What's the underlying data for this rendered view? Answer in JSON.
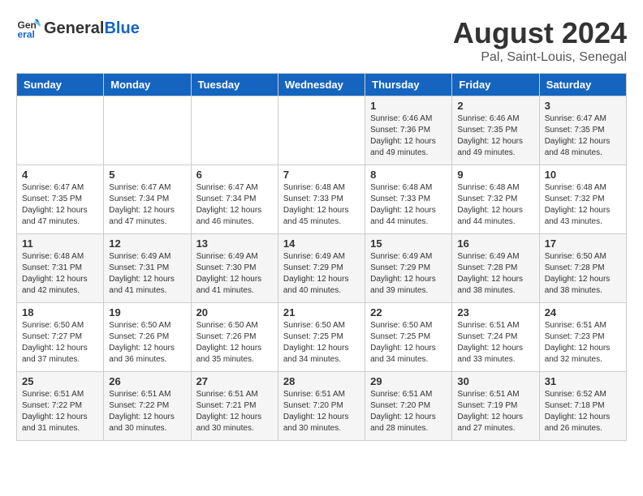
{
  "header": {
    "logo_general": "General",
    "logo_blue": "Blue",
    "month_year": "August 2024",
    "location": "Pal, Saint-Louis, Senegal"
  },
  "days_of_week": [
    "Sunday",
    "Monday",
    "Tuesday",
    "Wednesday",
    "Thursday",
    "Friday",
    "Saturday"
  ],
  "weeks": [
    [
      {
        "day": "",
        "info": ""
      },
      {
        "day": "",
        "info": ""
      },
      {
        "day": "",
        "info": ""
      },
      {
        "day": "",
        "info": ""
      },
      {
        "day": "1",
        "info": "Sunrise: 6:46 AM\nSunset: 7:36 PM\nDaylight: 12 hours\nand 49 minutes."
      },
      {
        "day": "2",
        "info": "Sunrise: 6:46 AM\nSunset: 7:35 PM\nDaylight: 12 hours\nand 49 minutes."
      },
      {
        "day": "3",
        "info": "Sunrise: 6:47 AM\nSunset: 7:35 PM\nDaylight: 12 hours\nand 48 minutes."
      }
    ],
    [
      {
        "day": "4",
        "info": "Sunrise: 6:47 AM\nSunset: 7:35 PM\nDaylight: 12 hours\nand 47 minutes."
      },
      {
        "day": "5",
        "info": "Sunrise: 6:47 AM\nSunset: 7:34 PM\nDaylight: 12 hours\nand 47 minutes."
      },
      {
        "day": "6",
        "info": "Sunrise: 6:47 AM\nSunset: 7:34 PM\nDaylight: 12 hours\nand 46 minutes."
      },
      {
        "day": "7",
        "info": "Sunrise: 6:48 AM\nSunset: 7:33 PM\nDaylight: 12 hours\nand 45 minutes."
      },
      {
        "day": "8",
        "info": "Sunrise: 6:48 AM\nSunset: 7:33 PM\nDaylight: 12 hours\nand 44 minutes."
      },
      {
        "day": "9",
        "info": "Sunrise: 6:48 AM\nSunset: 7:32 PM\nDaylight: 12 hours\nand 44 minutes."
      },
      {
        "day": "10",
        "info": "Sunrise: 6:48 AM\nSunset: 7:32 PM\nDaylight: 12 hours\nand 43 minutes."
      }
    ],
    [
      {
        "day": "11",
        "info": "Sunrise: 6:48 AM\nSunset: 7:31 PM\nDaylight: 12 hours\nand 42 minutes."
      },
      {
        "day": "12",
        "info": "Sunrise: 6:49 AM\nSunset: 7:31 PM\nDaylight: 12 hours\nand 41 minutes."
      },
      {
        "day": "13",
        "info": "Sunrise: 6:49 AM\nSunset: 7:30 PM\nDaylight: 12 hours\nand 41 minutes."
      },
      {
        "day": "14",
        "info": "Sunrise: 6:49 AM\nSunset: 7:29 PM\nDaylight: 12 hours\nand 40 minutes."
      },
      {
        "day": "15",
        "info": "Sunrise: 6:49 AM\nSunset: 7:29 PM\nDaylight: 12 hours\nand 39 minutes."
      },
      {
        "day": "16",
        "info": "Sunrise: 6:49 AM\nSunset: 7:28 PM\nDaylight: 12 hours\nand 38 minutes."
      },
      {
        "day": "17",
        "info": "Sunrise: 6:50 AM\nSunset: 7:28 PM\nDaylight: 12 hours\nand 38 minutes."
      }
    ],
    [
      {
        "day": "18",
        "info": "Sunrise: 6:50 AM\nSunset: 7:27 PM\nDaylight: 12 hours\nand 37 minutes."
      },
      {
        "day": "19",
        "info": "Sunrise: 6:50 AM\nSunset: 7:26 PM\nDaylight: 12 hours\nand 36 minutes."
      },
      {
        "day": "20",
        "info": "Sunrise: 6:50 AM\nSunset: 7:26 PM\nDaylight: 12 hours\nand 35 minutes."
      },
      {
        "day": "21",
        "info": "Sunrise: 6:50 AM\nSunset: 7:25 PM\nDaylight: 12 hours\nand 34 minutes."
      },
      {
        "day": "22",
        "info": "Sunrise: 6:50 AM\nSunset: 7:25 PM\nDaylight: 12 hours\nand 34 minutes."
      },
      {
        "day": "23",
        "info": "Sunrise: 6:51 AM\nSunset: 7:24 PM\nDaylight: 12 hours\nand 33 minutes."
      },
      {
        "day": "24",
        "info": "Sunrise: 6:51 AM\nSunset: 7:23 PM\nDaylight: 12 hours\nand 32 minutes."
      }
    ],
    [
      {
        "day": "25",
        "info": "Sunrise: 6:51 AM\nSunset: 7:22 PM\nDaylight: 12 hours\nand 31 minutes."
      },
      {
        "day": "26",
        "info": "Sunrise: 6:51 AM\nSunset: 7:22 PM\nDaylight: 12 hours\nand 30 minutes."
      },
      {
        "day": "27",
        "info": "Sunrise: 6:51 AM\nSunset: 7:21 PM\nDaylight: 12 hours\nand 30 minutes."
      },
      {
        "day": "28",
        "info": "Sunrise: 6:51 AM\nSunset: 7:20 PM\nDaylight: 12 hours\nand 30 minutes."
      },
      {
        "day": "29",
        "info": "Sunrise: 6:51 AM\nSunset: 7:20 PM\nDaylight: 12 hours\nand 28 minutes."
      },
      {
        "day": "30",
        "info": "Sunrise: 6:51 AM\nSunset: 7:19 PM\nDaylight: 12 hours\nand 27 minutes."
      },
      {
        "day": "31",
        "info": "Sunrise: 6:52 AM\nSunset: 7:18 PM\nDaylight: 12 hours\nand 26 minutes."
      }
    ]
  ]
}
